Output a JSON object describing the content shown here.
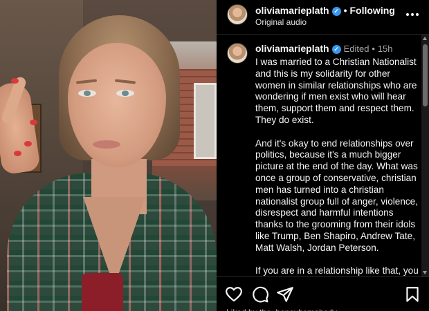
{
  "post": {
    "author": "oliviamarieplath",
    "follow_status": "Following",
    "audio": "Original audio",
    "separator": "•"
  },
  "caption": {
    "author": "oliviamarieplath",
    "edited": "Edited",
    "separator": "•",
    "age": "15h",
    "paragraphs": [
      "I was married to a Christian Nationalist and this is my solidarity for other women in similar relationships who are wondering if men exist who will hear them, support them and respect them. They do exist.",
      "And it's okay to end relationships over politics, because it's a much bigger picture at the end of the day. What was once a group of conservative, christian men has turned into a christian nationalist group full of anger, violence, disrespect and harmful intentions thanks to the grooming from their idols like Trump, Ben Shapiro, Andrew Tate, Matt Walsh, Jordan Peterson.",
      "If you are in a relationship like that, you deserve better. And it's not the outside"
    ]
  },
  "likes_peek": "Liked by the_honeyhomebody",
  "icons": {
    "verified": "verified-badge-icon",
    "more": "more-options-icon",
    "like": "heart-icon",
    "comment": "comment-icon",
    "share": "share-icon",
    "save": "bookmark-icon"
  },
  "colors": {
    "background": "#000000",
    "verified": "#3897f0",
    "secondary_text": "#a8a8a8"
  }
}
